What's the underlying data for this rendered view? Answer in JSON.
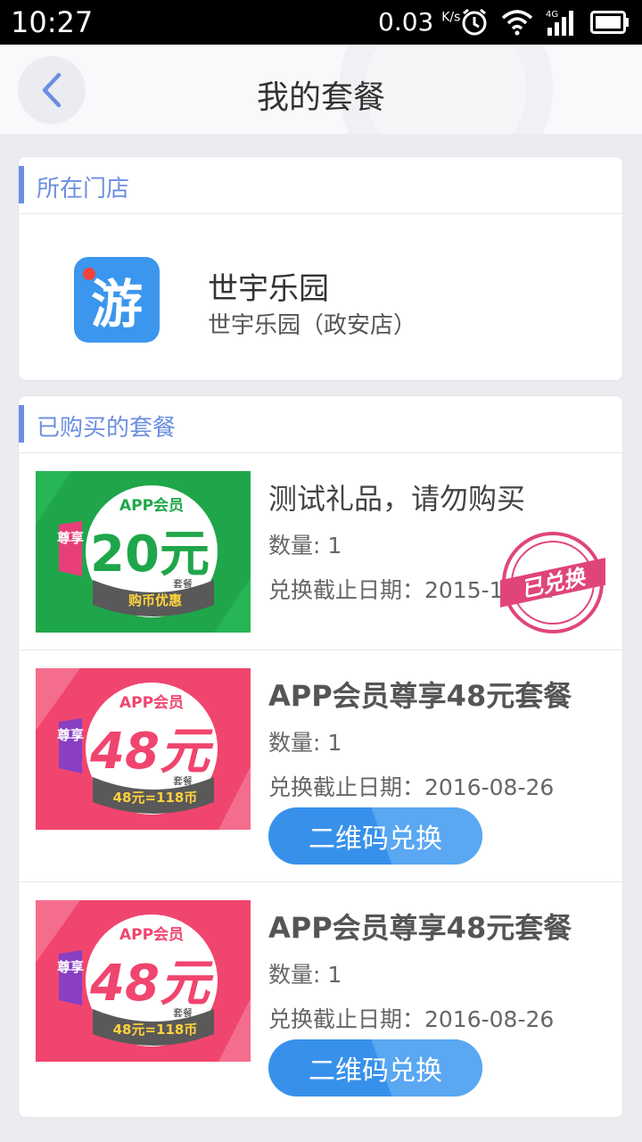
{
  "status_bar": {
    "time": "10:27",
    "speed": "0.03",
    "speed_unit": "K/s",
    "network": "4G",
    "icons": [
      "alarm-icon",
      "wifi-icon",
      "signal-icon",
      "battery-icon"
    ]
  },
  "header": {
    "title": "我的套餐",
    "back_icon": "chevron-left-icon"
  },
  "store_section": {
    "heading": "所在门店",
    "logo_text": "游",
    "name": "世宇乐园",
    "branch": "世宇乐园（政安店）"
  },
  "packages_section": {
    "heading": "已购买的套餐",
    "items": [
      {
        "title": "测试礼品，请勿购买",
        "qty_label": "数量: 1",
        "deadline_label": "兑换截止日期：2015-12-31",
        "status_stamp": "已兑换",
        "image": {
          "badge_top": "APP会员",
          "side_label": "尊享",
          "amount": "20元",
          "amount_sub": "套餐",
          "ribbon": "购币优惠",
          "bg_color": "#1fa64a"
        }
      },
      {
        "title": "APP会员尊享48元套餐",
        "qty_label": "数量: 1",
        "deadline_label": "兑换截止日期：2016-08-26",
        "button_label": "二维码兑换",
        "image": {
          "badge_top": "APP会员",
          "side_label": "尊享",
          "amount": "48元",
          "amount_sub": "套餐",
          "ribbon": "48元=118币",
          "bg_color": "#f0456e"
        }
      },
      {
        "title": "APP会员尊享48元套餐",
        "qty_label": "数量: 1",
        "deadline_label": "兑换截止日期：2016-08-26",
        "button_label": "二维码兑换",
        "image": {
          "badge_top": "APP会员",
          "side_label": "尊享",
          "amount": "48元",
          "amount_sub": "套餐",
          "ribbon": "48元=118币",
          "bg_color": "#f0456e"
        }
      }
    ]
  },
  "colors": {
    "accent_blue": "#3791eb",
    "section_accent": "#6d8de6",
    "stamp_pink": "#e0457a"
  }
}
